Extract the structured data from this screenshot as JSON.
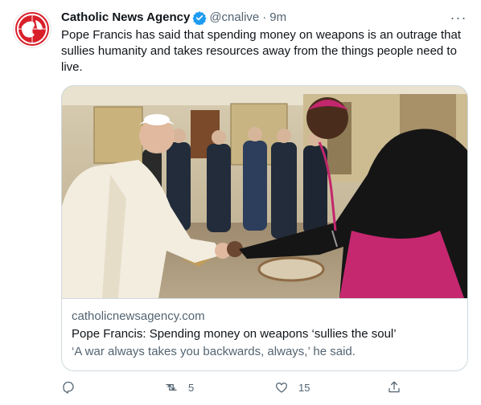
{
  "author": {
    "name": "Catholic News Agency",
    "handle": "@cnalive",
    "separator": "·",
    "time": "9m",
    "avatar_icon": "cna-globe-logo"
  },
  "tweet_text": "Pope Francis has said that spending money on weapons is an outrage that sullies humanity and takes resources away from the things people need to live.",
  "more_label": "···",
  "card": {
    "domain": "catholicnewsagency.com",
    "title": "Pope Francis: Spending money on weapons ‘sullies the soul’",
    "description": "‘A war always takes you backwards, always,’ he said."
  },
  "actions": {
    "reply_icon": "reply-icon",
    "retweet_icon": "retweet-icon",
    "retweet_count": "5",
    "like_icon": "heart-icon",
    "like_count": "15",
    "share_icon": "share-icon"
  },
  "colors": {
    "brand_red": "#d9202a",
    "verified_blue": "#1d9bf0",
    "secondary_text": "#536471",
    "border": "#cfd9de"
  }
}
